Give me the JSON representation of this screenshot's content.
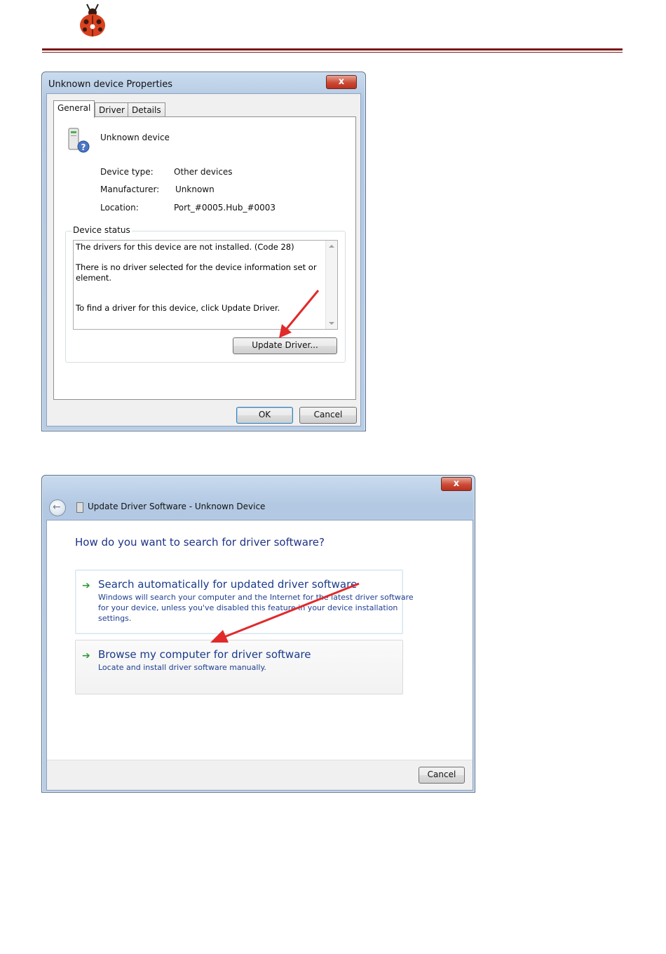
{
  "colors": {
    "header_rule": "#7a1515",
    "link_blue": "#1a3b8a",
    "heading_blue": "#1e3287",
    "arrow_green": "#2e9b35",
    "annotation_red": "#e12a2a"
  },
  "header": {
    "logo_icon": "ladybug-logo-icon"
  },
  "properties_dialog": {
    "title": "Unknown device Properties",
    "close_label": "x",
    "tabs": [
      {
        "label": "General"
      },
      {
        "label": "Driver"
      },
      {
        "label": "Details"
      }
    ],
    "device_name": "Unknown device",
    "fields": [
      {
        "label": "Device type:",
        "value": "Other devices"
      },
      {
        "label": "Manufacturer:",
        "value": "Unknown"
      },
      {
        "label": "Location:",
        "value": "Port_#0005.Hub_#0003"
      }
    ],
    "status_group_title": "Device status",
    "status_lines": [
      "The drivers for this device are not installed. (Code 28)",
      "There is no driver selected for the device information set or",
      "element.",
      "To find a driver for this device, click Update Driver."
    ],
    "update_driver_label": "Update Driver...",
    "ok_label": "OK",
    "cancel_label": "Cancel"
  },
  "update_dialog": {
    "close_label": "x",
    "title": "Update Driver Software - Unknown Device",
    "question": "How do you want to search for driver software?",
    "options": [
      {
        "title": "Search automatically for updated driver software",
        "desc": [
          "Windows will search your computer and the Internet for the latest driver software",
          "for your device, unless you've disabled this feature in your device installation",
          "settings."
        ]
      },
      {
        "title": "Browse my computer for driver software",
        "desc": [
          "Locate and install driver software manually."
        ]
      }
    ],
    "cancel_label": "Cancel"
  }
}
